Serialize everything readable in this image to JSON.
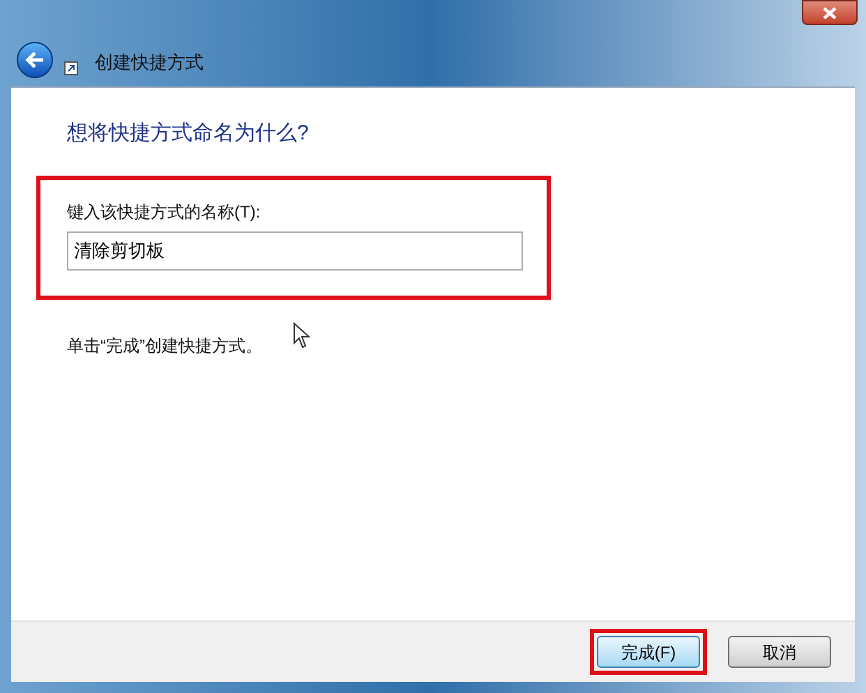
{
  "window": {
    "title": "创建快捷方式"
  },
  "heading": "想将快捷方式命名为什么?",
  "name_field": {
    "label": "键入该快捷方式的名称(T):",
    "value": "清除剪切板",
    "highlighted": true
  },
  "hint": "单击“完成”创建快捷方式。",
  "buttons": [
    {
      "label": "完成(F)",
      "kind": "primary",
      "highlighted": true
    },
    {
      "label": "取消",
      "kind": "normal",
      "highlighted": false
    }
  ]
}
